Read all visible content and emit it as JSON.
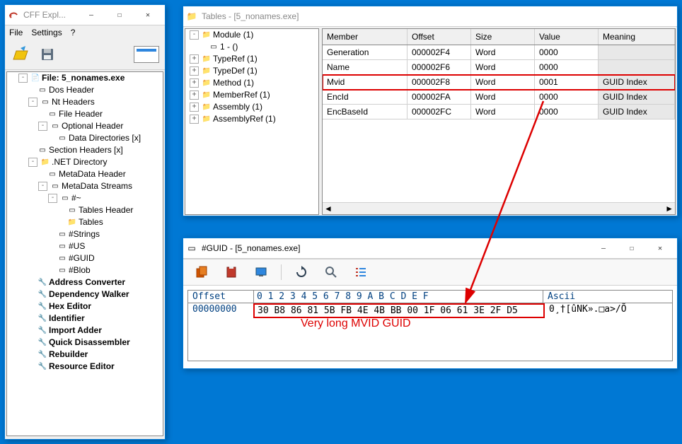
{
  "cff": {
    "title": "CFF Expl...",
    "menu": {
      "file": "File",
      "settings": "Settings",
      "help": "?"
    },
    "tree": {
      "file": "File: 5_nonames.exe",
      "dos": "Dos Header",
      "nt": "Nt Headers",
      "fileheader": "File Header",
      "optional": "Optional Header",
      "datadir": "Data Directories [x]",
      "section": "Section Headers [x]",
      "netdir": ".NET Directory",
      "metaheader": "MetaData Header",
      "metastreams": "MetaData Streams",
      "htilde": "#~",
      "tablesheader": "Tables Header",
      "tables": "Tables",
      "strings": "#Strings",
      "us": "#US",
      "guid": "#GUID",
      "blob": "#Blob",
      "addrconv": "Address Converter",
      "depwalk": "Dependency Walker",
      "hexed": "Hex Editor",
      "ident": "Identifier",
      "impadd": "Import Adder",
      "quickdis": "Quick Disassembler",
      "rebuilder": "Rebuilder",
      "resed": "Resource Editor"
    }
  },
  "tables": {
    "title": "Tables - [5_nonames.exe]",
    "module": {
      "root": "Module (1)",
      "child": "1 - ()",
      "typeref": "TypeRef (1)",
      "typedef": "TypeDef (1)",
      "method": "Method (1)",
      "memberref": "MemberRef (1)",
      "assembly": "Assembly (1)",
      "assemblyref": "AssemblyRef (1)"
    },
    "headers": {
      "member": "Member",
      "offset": "Offset",
      "size": "Size",
      "value": "Value",
      "meaning": "Meaning"
    },
    "rows": [
      {
        "member": "Generation",
        "offset": "000002F4",
        "size": "Word",
        "value": "0000",
        "meaning": ""
      },
      {
        "member": "Name",
        "offset": "000002F6",
        "size": "Word",
        "value": "0000",
        "meaning": ""
      },
      {
        "member": "Mvid",
        "offset": "000002F8",
        "size": "Word",
        "value": "0001",
        "meaning": "GUID Index"
      },
      {
        "member": "EncId",
        "offset": "000002FA",
        "size": "Word",
        "value": "0000",
        "meaning": "GUID Index"
      },
      {
        "member": "EncBaseId",
        "offset": "000002FC",
        "size": "Word",
        "value": "0000",
        "meaning": "GUID Index"
      }
    ]
  },
  "guid": {
    "title": "#GUID - [5_nonames.exe]",
    "headers": {
      "offset": "Offset",
      "bytes": " 0  1  2  3  4  5  6  7  8  9  A  B  C  D  E  F",
      "ascii": "Ascii"
    },
    "row": {
      "offset": "00000000",
      "bytes": "30 B8 86 81 5B FB 4E 4B BB 00 1F 06 61 3E 2F D5",
      "ascii": "0¸†[ûNK».□a>/Õ"
    }
  },
  "annotation": "Very long MVID GUID"
}
